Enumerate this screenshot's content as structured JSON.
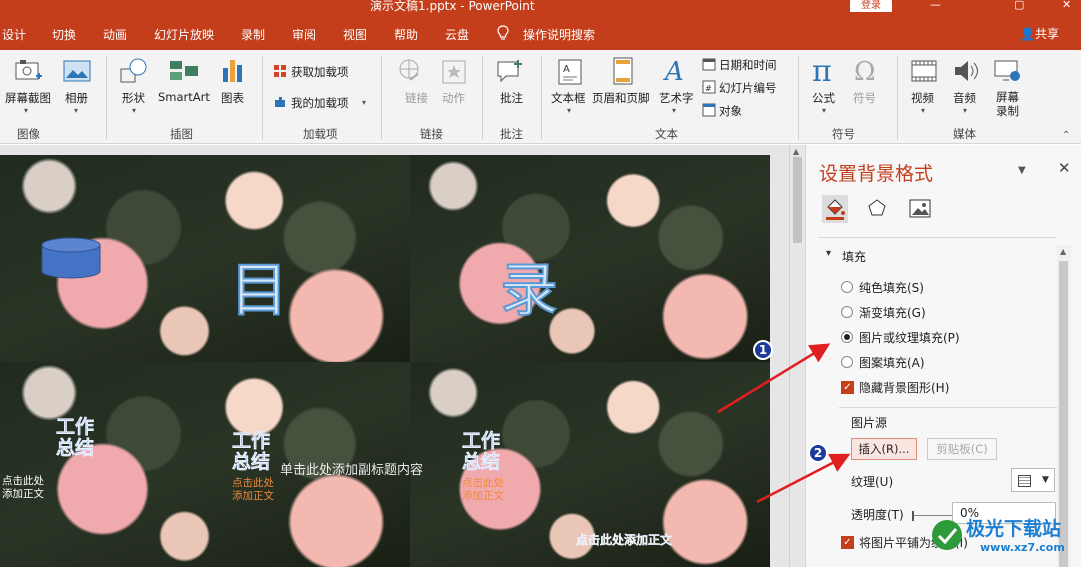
{
  "titlebar": {
    "doc_title": "演示文稿1.pptx  -  PowerPoint",
    "login_button": "登录",
    "minimize": "—",
    "restore": "▢",
    "close": "✕"
  },
  "menu": {
    "items": [
      "设计",
      "切换",
      "动画",
      "幻灯片放映",
      "录制",
      "审阅",
      "视图",
      "帮助",
      "云盘"
    ],
    "search": "操作说明搜索",
    "share": "共享"
  },
  "ribbon": {
    "screenshot": "屏幕截图",
    "album": "相册",
    "group_image": "图像",
    "shapes": "形状",
    "smartart": "SmartArt",
    "chart": "图表",
    "group_illustrations": "插图",
    "get_addins": "获取加载项",
    "my_addins": "我的加载项",
    "group_addins": "加载项",
    "link": "链接",
    "action": "动作",
    "group_links": "链接",
    "comment": "批注",
    "group_comments": "批注",
    "textbox": "文本框",
    "header_footer": "页眉和页脚",
    "wordart": "艺术字",
    "datetime": "日期和时间",
    "slide_number": "幻灯片编号",
    "object": "对象",
    "group_text": "文本",
    "equation": "公式",
    "symbol": "符号",
    "group_symbols": "符号",
    "video": "视频",
    "audio": "音频",
    "screen_record": "屏幕录制",
    "group_media": "媒体",
    "collapse_icon": "chevron-up-icon"
  },
  "slide": {
    "title_left": "目",
    "title_right": "录",
    "work_summary": "工作总结",
    "click_add_text": "点击此处添加正文",
    "click_add_subtitle": "单击此处添加副标题内容",
    "bottom_text": "点击此处添加正文"
  },
  "pane": {
    "title": "设置背景格式",
    "section": "填充",
    "options": [
      "纯色填充(S)",
      "渐变填充(G)",
      "图片或纹理填充(P)",
      "图案填充(A)"
    ],
    "selected_option": 2,
    "hide_bg_graphics": "隐藏背景图形(H)",
    "picture_source": "图片源",
    "insert_button": "插入(R)...",
    "clipboard_button": "剪贴板(C)",
    "texture_label": "纹理(U)",
    "transparency_label": "透明度(T)",
    "transparency_value": "0%",
    "tile_checkbox": "将图片平铺为纹理(I)"
  },
  "annotations": {
    "marker1": "1",
    "marker2": "2"
  },
  "watermark": {
    "cn": "极光下载站",
    "url": "www.xz7.com"
  }
}
